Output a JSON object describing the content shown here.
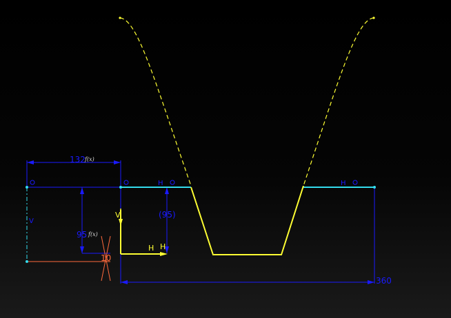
{
  "colors": {
    "constraint_blue": "#1a1aff",
    "profile_yellow": "#ffff33",
    "axis_cyan": "#33ddee",
    "dim_orange": "#ff6a3c",
    "formula_label": "#dcdcdc"
  },
  "dimensions": {
    "width_label": "132",
    "width_formula": "f(x)",
    "height_label": "95",
    "height_formula": "f(x)",
    "right_height_label": "(95)",
    "offset_label": "10",
    "total_label": "360"
  },
  "constraints": {
    "vertical_left": "V",
    "vertical_profile": "V",
    "horizontal_top_middle": "H",
    "horizontal_top_right": "H",
    "horizontal_bottom_1": "H",
    "horizontal_bottom_2": "H"
  },
  "icons": {
    "coincidence": "circle-icon"
  }
}
